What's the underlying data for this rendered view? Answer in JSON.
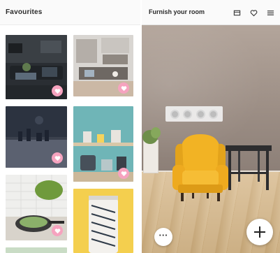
{
  "left_panel": {
    "title": "Favourites"
  },
  "right_panel": {
    "title": "Furnish your room",
    "header_icons": [
      "cube-outline-icon",
      "heart-outline-icon",
      "menu-lines-icon"
    ],
    "color_swatches": 4,
    "more_button_label": "···",
    "add_button_icon": "plus-icon"
  },
  "colors": {
    "favourite_heart": "#f6a3bf",
    "chair_yellow": "#f2b324",
    "table_dark": "#2d2d2f"
  }
}
